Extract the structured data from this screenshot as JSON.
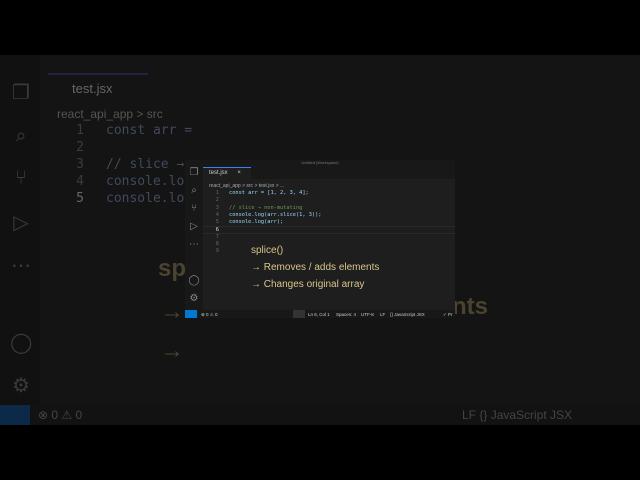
{
  "tab": {
    "label": "test.jsx"
  },
  "breadcrumb": {
    "text": "react_api_app > src > test.jsx > ..."
  },
  "title": "Untitled (Workspace)",
  "code": [
    {
      "n": "1",
      "text": "const arr = [1, 2, 3, 4];"
    },
    {
      "n": "2",
      "text": ""
    },
    {
      "n": "3",
      "text": "// slice → non-mutating"
    },
    {
      "n": "4",
      "text": "console.log(arr.slice(1, 3));"
    },
    {
      "n": "5",
      "text": "console.log(arr);"
    },
    {
      "n": "6",
      "text": ""
    },
    {
      "n": "7",
      "text": ""
    },
    {
      "n": "8",
      "text": ""
    },
    {
      "n": "9",
      "text": ""
    }
  ],
  "overlay": {
    "title": "splice()",
    "line1": "→ Removes / adds elements",
    "line2": "→ Changes original array"
  },
  "status": {
    "problems": "⊗ 0 ⚠ 0",
    "position": "Ln 6, Col 1",
    "spaces": "Spaces: 4",
    "encoding": "UTF-8",
    "eol": "LF",
    "language": "{} JavaScript JSX",
    "prettier": "✓ Pr"
  },
  "bg": {
    "tab": "test.jsx",
    "crumb": "react_api_app > src",
    "code1": "const arr =",
    "code3": "// slice →",
    "code4": "console.lo",
    "code5": "console.lo",
    "big1": "spl",
    "big2": "nts",
    "arrow": "→",
    "status_left": "⊗ 0 ⚠ 0",
    "status_right": "LF   {} JavaScript JSX"
  }
}
